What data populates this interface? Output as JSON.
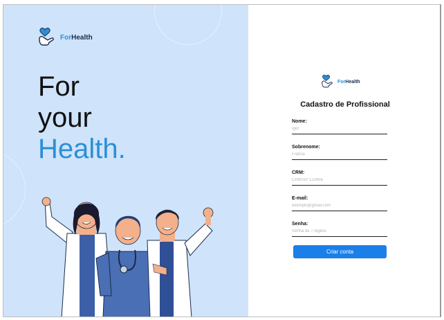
{
  "brand": {
    "name_prefix": "For",
    "name_suffix": "Health"
  },
  "hero": {
    "line1": "For",
    "line2": "your",
    "line3": "Health."
  },
  "form": {
    "title": "Cadastro de Profissional",
    "fields": [
      {
        "label": "Nome:",
        "placeholder": "Igor"
      },
      {
        "label": "Sobrenome:",
        "placeholder": "Franca"
      },
      {
        "label": "CRM:",
        "placeholder": "CRM/SP 123456"
      },
      {
        "label": "E-mail:",
        "placeholder": "exemplo@gmail.com"
      },
      {
        "label": "Senha:",
        "placeholder": "Senha de 7 dígitos"
      }
    ],
    "submit_label": "Criar conta"
  },
  "colors": {
    "accent": "#2a8fd6",
    "panel": "#cfe3fb",
    "button": "#1a7fe8"
  }
}
